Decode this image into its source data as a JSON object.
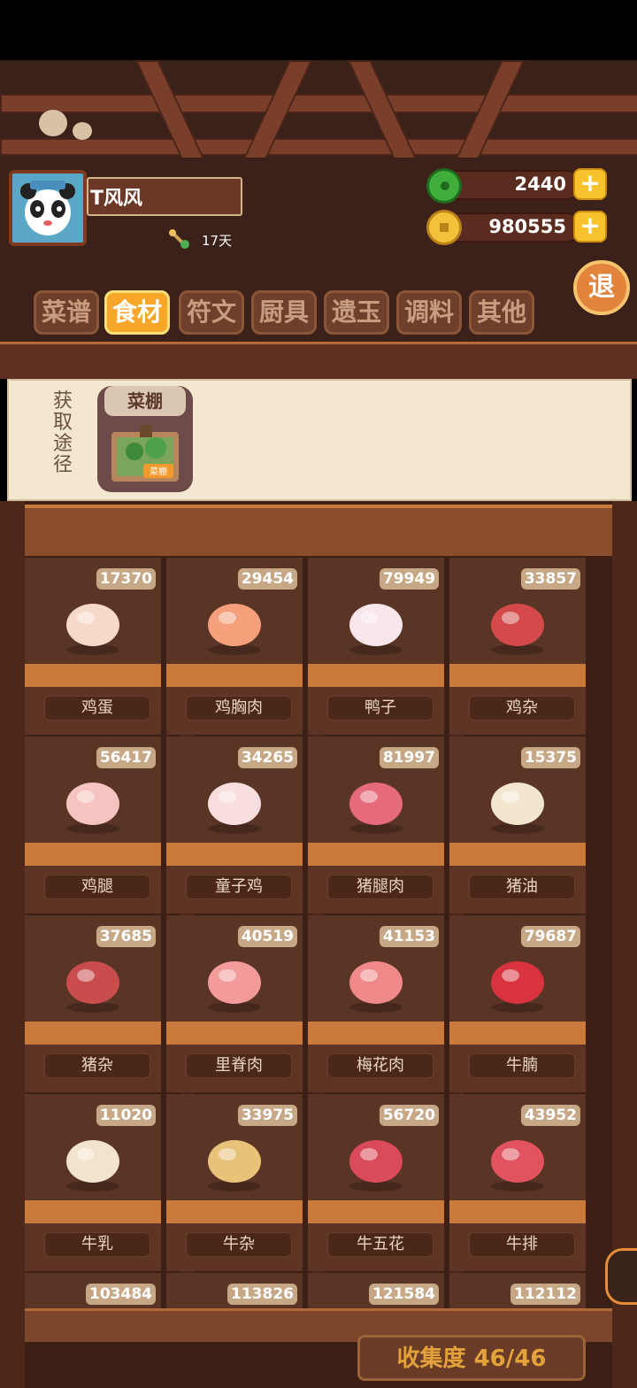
{
  "player": {
    "name": "T风风",
    "days": "17天"
  },
  "currency": {
    "jade": "2440",
    "coins": "980555",
    "plus": "+"
  },
  "exit_label": "退",
  "tabs": [
    "菜谱",
    "食材",
    "符文",
    "厨具",
    "遗玉",
    "调料",
    "其他"
  ],
  "active_tab": "食材",
  "source": {
    "label": "获取途径",
    "name": "菜棚",
    "sign": "菜棚"
  },
  "ingredients": [
    {
      "name": "鸡蛋",
      "count": "17370",
      "icon": "egg-icon",
      "color": "#f6d9c8"
    },
    {
      "name": "鸡胸肉",
      "count": "29454",
      "icon": "chicken-breast-icon",
      "color": "#f5a07a"
    },
    {
      "name": "鸭子",
      "count": "79949",
      "icon": "duck-icon",
      "color": "#f8e6ea"
    },
    {
      "name": "鸡杂",
      "count": "33857",
      "icon": "chicken-offal-icon",
      "color": "#d44a4a"
    },
    {
      "name": "鸡腿",
      "count": "56417",
      "icon": "drumstick-icon",
      "color": "#f6c4c0"
    },
    {
      "name": "童子鸡",
      "count": "34265",
      "icon": "young-chicken-icon",
      "color": "#f8dede"
    },
    {
      "name": "猪腿肉",
      "count": "81997",
      "icon": "pork-leg-icon",
      "color": "#e56a7a"
    },
    {
      "name": "猪油",
      "count": "15375",
      "icon": "lard-icon",
      "color": "#f2e6cf"
    },
    {
      "name": "猪杂",
      "count": "37685",
      "icon": "pork-offal-icon",
      "color": "#c94d4d"
    },
    {
      "name": "里脊肉",
      "count": "40519",
      "icon": "tenderloin-icon",
      "color": "#f39a9a"
    },
    {
      "name": "梅花肉",
      "count": "41153",
      "icon": "pork-shoulder-icon",
      "color": "#f08a8a"
    },
    {
      "name": "牛腩",
      "count": "79687",
      "icon": "beef-brisket-icon",
      "color": "#d8333f"
    },
    {
      "name": "牛乳",
      "count": "11020",
      "icon": "milk-jar-icon",
      "color": "#f2e3cc"
    },
    {
      "name": "牛杂",
      "count": "33975",
      "icon": "beef-offal-icon",
      "color": "#e9c27a"
    },
    {
      "name": "牛五花",
      "count": "56720",
      "icon": "beef-belly-icon",
      "color": "#d94a5a"
    },
    {
      "name": "牛排",
      "count": "43952",
      "icon": "steak-icon",
      "color": "#e0535f"
    },
    {
      "name": "",
      "count": "103484",
      "icon": "",
      "color": ""
    },
    {
      "name": "",
      "count": "113826",
      "icon": "",
      "color": ""
    },
    {
      "name": "",
      "count": "121584",
      "icon": "",
      "color": ""
    },
    {
      "name": "",
      "count": "112112",
      "icon": "",
      "color": ""
    }
  ],
  "collection": "收集度 46/46"
}
